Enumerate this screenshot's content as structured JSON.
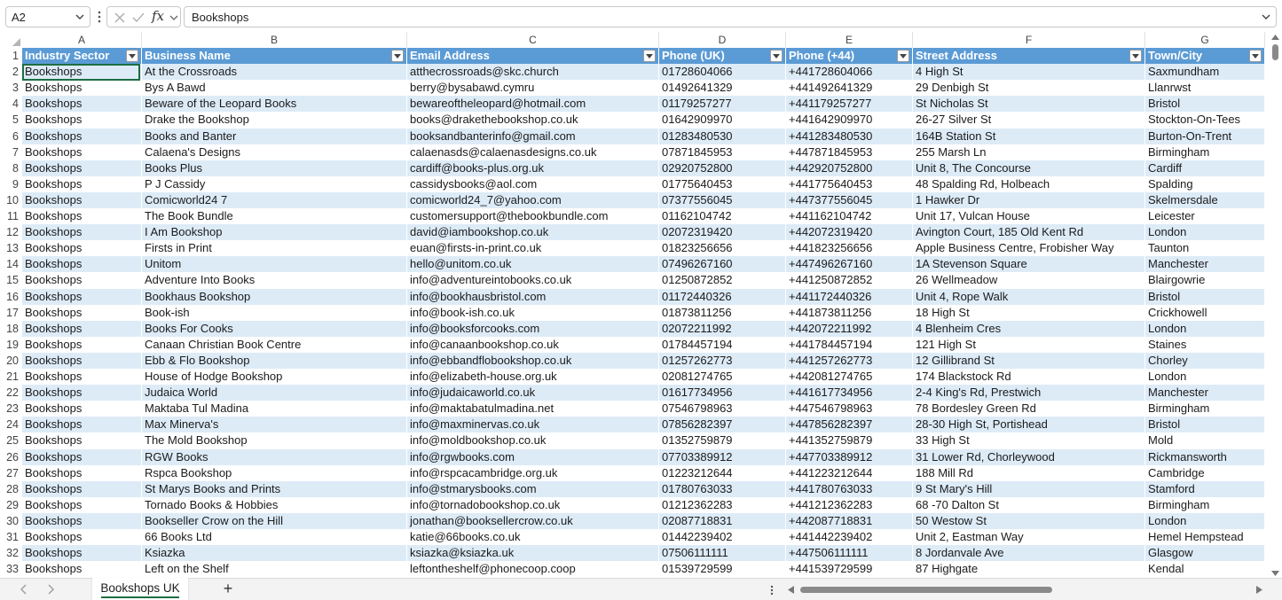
{
  "formula_bar": {
    "cell_reference": "A2",
    "formula_value": "Bookshops",
    "fx_label": "fx"
  },
  "columns": [
    "A",
    "B",
    "C",
    "D",
    "E",
    "F",
    "G"
  ],
  "table_headers": [
    "Industry Sector",
    "Business Name",
    "Email Address",
    "Phone (UK)",
    "Phone (+44)",
    "Street Address",
    "Town/City"
  ],
  "rows": [
    {
      "num": "2",
      "cells": [
        "Bookshops",
        "At the Crossroads",
        "atthecrossroads@skc.church",
        "01728604066",
        "+441728604066",
        "4 High St",
        "Saxmundham"
      ]
    },
    {
      "num": "3",
      "cells": [
        "Bookshops",
        "Bys A Bawd",
        "berry@bysabawd.cymru",
        "01492641329",
        "+441492641329",
        "29 Denbigh St",
        "Llanrwst"
      ]
    },
    {
      "num": "4",
      "cells": [
        "Bookshops",
        "Beware of the Leopard Books",
        "bewareoftheleopard@hotmail.com",
        "01179257277",
        "+441179257277",
        "St Nicholas St",
        "Bristol"
      ]
    },
    {
      "num": "5",
      "cells": [
        "Bookshops",
        "Drake the Bookshop",
        "books@drakethebookshop.co.uk",
        "01642909970",
        "+441642909970",
        "26-27 Silver St",
        "Stockton-On-Tees"
      ]
    },
    {
      "num": "6",
      "cells": [
        "Bookshops",
        "Books and Banter",
        "booksandbanterinfo@gmail.com",
        "01283480530",
        "+441283480530",
        "164B Station St",
        "Burton-On-Trent"
      ]
    },
    {
      "num": "7",
      "cells": [
        "Bookshops",
        "Calaena's Designs",
        "calaenasds@calaenasdesigns.co.uk",
        "07871845953",
        "+447871845953",
        "255 Marsh Ln",
        "Birmingham"
      ]
    },
    {
      "num": "8",
      "cells": [
        "Bookshops",
        "Books Plus",
        "cardiff@books-plus.org.uk",
        "02920752800",
        "+442920752800",
        "Unit 8, The Concourse",
        "Cardiff"
      ]
    },
    {
      "num": "9",
      "cells": [
        "Bookshops",
        "P J Cassidy",
        "cassidysbooks@aol.com",
        "01775640453",
        "+441775640453",
        "48 Spalding Rd, Holbeach",
        "Spalding"
      ]
    },
    {
      "num": "10",
      "cells": [
        "Bookshops",
        "Comicworld24 7",
        "comicworld24_7@yahoo.com",
        "07377556045",
        "+447377556045",
        "1 Hawker Dr",
        "Skelmersdale"
      ]
    },
    {
      "num": "11",
      "cells": [
        "Bookshops",
        "The Book Bundle",
        "customersupport@thebookbundle.com",
        "01162104742",
        "+441162104742",
        "Unit 17, Vulcan House",
        "Leicester"
      ]
    },
    {
      "num": "12",
      "cells": [
        "Bookshops",
        "I Am Bookshop",
        "david@iambookshop.co.uk",
        "02072319420",
        "+442072319420",
        "Avington Court, 185 Old Kent Rd",
        "London"
      ]
    },
    {
      "num": "13",
      "cells": [
        "Bookshops",
        "Firsts in Print",
        "euan@firsts-in-print.co.uk",
        "01823256656",
        "+441823256656",
        "Apple Business Centre, Frobisher Way",
        "Taunton"
      ]
    },
    {
      "num": "14",
      "cells": [
        "Bookshops",
        "Unitom",
        "hello@unitom.co.uk",
        "07496267160",
        "+447496267160",
        "1A Stevenson Square",
        "Manchester"
      ]
    },
    {
      "num": "15",
      "cells": [
        "Bookshops",
        "Adventure Into Books",
        "info@adventureintobooks.co.uk",
        "01250872852",
        "+441250872852",
        "26 Wellmeadow",
        "Blairgowrie"
      ]
    },
    {
      "num": "16",
      "cells": [
        "Bookshops",
        "Bookhaus Bookshop",
        "info@bookhausbristol.com",
        "01172440326",
        "+441172440326",
        "Unit 4, Rope Walk",
        "Bristol"
      ]
    },
    {
      "num": "17",
      "cells": [
        "Bookshops",
        "Book-ish",
        "info@book-ish.co.uk",
        "01873811256",
        "+441873811256",
        "18 High St",
        "Crickhowell"
      ]
    },
    {
      "num": "18",
      "cells": [
        "Bookshops",
        "Books For Cooks",
        "info@booksforcooks.com",
        "02072211992",
        "+442072211992",
        "4 Blenheim Cres",
        "London"
      ]
    },
    {
      "num": "19",
      "cells": [
        "Bookshops",
        "Canaan Christian Book Centre",
        "info@canaanbookshop.co.uk",
        "01784457194",
        "+441784457194",
        "121 High St",
        "Staines"
      ]
    },
    {
      "num": "20",
      "cells": [
        "Bookshops",
        "Ebb & Flo Bookshop",
        "info@ebbandflobookshop.co.uk",
        "01257262773",
        "+441257262773",
        "12 Gillibrand St",
        "Chorley"
      ]
    },
    {
      "num": "21",
      "cells": [
        "Bookshops",
        "House of Hodge Bookshop",
        "info@elizabeth-house.org.uk",
        "02081274765",
        "+442081274765",
        "174 Blackstock Rd",
        "London"
      ]
    },
    {
      "num": "22",
      "cells": [
        "Bookshops",
        "Judaica World",
        "info@judaicaworld.co.uk",
        "01617734956",
        "+441617734956",
        "2-4 King's Rd, Prestwich",
        "Manchester"
      ]
    },
    {
      "num": "23",
      "cells": [
        "Bookshops",
        "Maktaba Tul Madina",
        "info@maktabatulmadina.net",
        "07546798963",
        "+447546798963",
        "78 Bordesley Green Rd",
        "Birmingham"
      ]
    },
    {
      "num": "24",
      "cells": [
        "Bookshops",
        "Max Minerva's",
        "info@maxminervas.co.uk",
        "07856282397",
        "+447856282397",
        "28-30 High St, Portishead",
        "Bristol"
      ]
    },
    {
      "num": "25",
      "cells": [
        "Bookshops",
        "The Mold Bookshop",
        "info@moldbookshop.co.uk",
        "01352759879",
        "+441352759879",
        "33 High St",
        "Mold"
      ]
    },
    {
      "num": "26",
      "cells": [
        "Bookshops",
        "RGW Books",
        "info@rgwbooks.com",
        "07703389912",
        "+447703389912",
        "31 Lower Rd, Chorleywood",
        "Rickmansworth"
      ]
    },
    {
      "num": "27",
      "cells": [
        "Bookshops",
        "Rspca Bookshop",
        "info@rspcacambridge.org.uk",
        "01223212644",
        "+441223212644",
        "188 Mill Rd",
        "Cambridge"
      ]
    },
    {
      "num": "28",
      "cells": [
        "Bookshops",
        "St Marys Books and Prints",
        "info@stmarysbooks.com",
        "01780763033",
        "+441780763033",
        "9 St Mary's Hill",
        "Stamford"
      ]
    },
    {
      "num": "29",
      "cells": [
        "Bookshops",
        "Tornado Books & Hobbies",
        "info@tornadobookshop.co.uk",
        "01212362283",
        "+441212362283",
        "68 -70 Dalton St",
        "Birmingham"
      ]
    },
    {
      "num": "30",
      "cells": [
        "Bookshops",
        "Bookseller Crow on the Hill",
        "jonathan@booksellercrow.co.uk",
        "02087718831",
        "+442087718831",
        "50 Westow St",
        "London"
      ]
    },
    {
      "num": "31",
      "cells": [
        "Bookshops",
        "66 Books Ltd",
        "katie@66books.co.uk",
        "01442239402",
        "+441442239402",
        "Unit 2, Eastman Way",
        "Hemel Hempstead"
      ]
    },
    {
      "num": "32",
      "cells": [
        "Bookshops",
        "Ksiazka",
        "ksiazka@ksiazka.uk",
        "07506111111",
        "+447506111111",
        "8 Jordanvale Ave",
        "Glasgow"
      ]
    },
    {
      "num": "33",
      "cells": [
        "Bookshops",
        "Left on the Shelf",
        "leftontheshelf@phonecoop.coop",
        "01539729599",
        "+441539729599",
        "87 Highgate",
        "Kendal"
      ]
    }
  ],
  "sheet_tabs": [
    "Bookshops UK"
  ],
  "add_sheet_label": "+",
  "colors": {
    "header_fill": "#5b9bd5",
    "band_fill": "#ddebf7",
    "selection_border": "#1e6e42"
  }
}
